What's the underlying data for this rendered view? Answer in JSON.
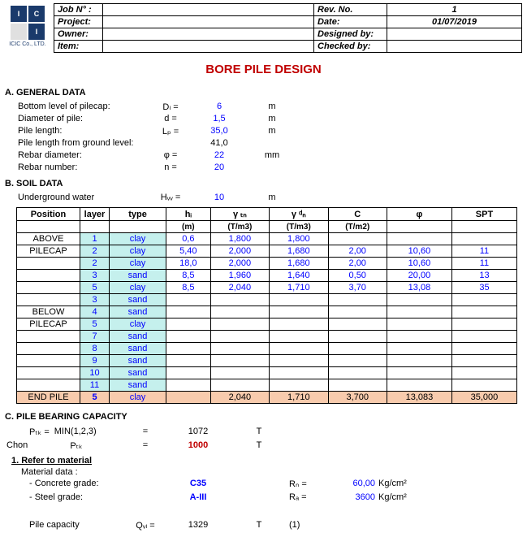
{
  "header": {
    "jobno_lbl": "Job N° :",
    "project_lbl": "Project:",
    "owner_lbl": "Owner:",
    "item_lbl": "Item:",
    "revno_lbl": "Rev. No.",
    "date_lbl": "Date:",
    "designed_lbl": "Designed by:",
    "checked_lbl": "Checked by:",
    "revno": "1",
    "date": "01/07/2019",
    "designed": "",
    "checked": ""
  },
  "logo_text": "ICIC Co., LTD.",
  "title": "BORE PILE DESIGN",
  "sectA": "A. GENERAL DATA",
  "general": {
    "r1_lbl": "Bottom level of pilecap:",
    "r1_sym": "Dₗ =",
    "r1_val": "6",
    "r1_unit": "m",
    "r2_lbl": "Diameter of pile:",
    "r2_sym": "d =",
    "r2_val": "1,5",
    "r2_unit": "m",
    "r3_lbl": "Pile length:",
    "r3_sym": "Lₚ =",
    "r3_val": "35,0",
    "r3_unit": "m",
    "r4_lbl": "Pile length from ground level:",
    "r4_val": "41,0",
    "r5_lbl": "Rebar diameter:",
    "r5_sym": "φ =",
    "r5_val": "22",
    "r5_unit": "mm",
    "r6_lbl": "Rebar number:",
    "r6_sym": "n =",
    "r6_val": "20"
  },
  "sectB": "B. SOIL DATA",
  "uw_lbl": "Underground water",
  "uw_sym": "Hᵥᵥ =",
  "uw_val": "10",
  "uw_unit": "m",
  "soil_headers": {
    "pos": "Position",
    "layer": "layer",
    "type": "type",
    "hi": "hᵢ",
    "gtn": "γ ₜₙ",
    "gdn": "γ ᵈₙ",
    "C": "C",
    "phi": "φ",
    "spt": "SPT",
    "u_m": "(m)",
    "u_tm3": "(T/m3)",
    "u_tm2": "(T/m2)"
  },
  "soil_rows": [
    {
      "pos": "ABOVE",
      "layer": "1",
      "type": "clay",
      "hi": "0,6",
      "gtn": "1,800",
      "gdn": "1,800",
      "C": "",
      "phi": "",
      "spt": ""
    },
    {
      "pos": "PILECAP",
      "layer": "2",
      "type": "clay",
      "hi": "5,40",
      "gtn": "2,000",
      "gdn": "1,680",
      "C": "2,00",
      "phi": "10,60",
      "spt": "11"
    },
    {
      "pos": "",
      "layer": "2",
      "type": "clay",
      "hi": "18,0",
      "gtn": "2,000",
      "gdn": "1,680",
      "C": "2,00",
      "phi": "10,60",
      "spt": "11",
      "below": true
    },
    {
      "pos": "",
      "layer": "3",
      "type": "sand",
      "hi": "8,5",
      "gtn": "1,960",
      "gdn": "1,640",
      "C": "0,50",
      "phi": "20,00",
      "spt": "13",
      "below": true
    },
    {
      "pos": "",
      "layer": "5",
      "type": "clay",
      "hi": "8,5",
      "gtn": "2,040",
      "gdn": "1,710",
      "C": "3,70",
      "phi": "13,08",
      "spt": "35",
      "below": true
    },
    {
      "pos": "",
      "layer": "3",
      "type": "sand",
      "hi": "",
      "gtn": "",
      "gdn": "",
      "C": "",
      "phi": "",
      "spt": "",
      "below": true
    },
    {
      "pos": "BELOW",
      "layer": "4",
      "type": "sand",
      "hi": "",
      "gtn": "",
      "gdn": "",
      "C": "",
      "phi": "",
      "spt": "",
      "below": true
    },
    {
      "pos": "PILECAP",
      "layer": "5",
      "type": "clay",
      "hi": "",
      "gtn": "",
      "gdn": "",
      "C": "",
      "phi": "",
      "spt": "",
      "below": true
    },
    {
      "pos": "",
      "layer": "7",
      "type": "sand",
      "hi": "",
      "gtn": "",
      "gdn": "",
      "C": "",
      "phi": "",
      "spt": "",
      "below": true
    },
    {
      "pos": "",
      "layer": "8",
      "type": "sand",
      "hi": "",
      "gtn": "",
      "gdn": "",
      "C": "",
      "phi": "",
      "spt": "",
      "below": true
    },
    {
      "pos": "",
      "layer": "9",
      "type": "sand",
      "hi": "",
      "gtn": "",
      "gdn": "",
      "C": "",
      "phi": "",
      "spt": "",
      "below": true
    },
    {
      "pos": "",
      "layer": "10",
      "type": "sand",
      "hi": "",
      "gtn": "",
      "gdn": "",
      "C": "",
      "phi": "",
      "spt": "",
      "below": true
    },
    {
      "pos": "",
      "layer": "11",
      "type": "sand",
      "hi": "",
      "gtn": "",
      "gdn": "",
      "C": "",
      "phi": "",
      "spt": "",
      "below": true
    }
  ],
  "end_pile": {
    "pos": "END PILE",
    "layer": "5",
    "type": "clay",
    "hi": "",
    "gtn": "2,040",
    "gdn": "1,710",
    "C": "3,700",
    "phi": "13,083",
    "spt": "35,000"
  },
  "sectC": "C. PILE BEARING CAPACITY",
  "bc": {
    "ptk_lbl": "Pₜₖ =",
    "min_lbl": "MIN(1,2,3)",
    "eq": "=",
    "ptk_val": "1072",
    "ptk_unit": "T",
    "chon": "Chon",
    "ptk2_lbl": "Pₜₖ",
    "eq2": "=",
    "chosen": "1000",
    "chosen_unit": "T"
  },
  "refmat": "1. Refer to material",
  "matdata": "Material data :",
  "mat": {
    "conc_lbl": "- Concrete grade:",
    "conc_val": "C35",
    "rn_lbl": "Rₙ =",
    "rn_val": "60,00",
    "rn_unit": "Kg/cm²",
    "steel_lbl": "- Steel grade:",
    "steel_val": "A-III",
    "ra_lbl": "Rₐ =",
    "ra_val": "3600",
    "ra_unit": "Kg/cm²",
    "pc_lbl": "Pile capacity",
    "qvl_sym": "Qᵥₗ =",
    "qvl_val": "1329",
    "qvl_unit": "T",
    "qvl_note": "(1)"
  }
}
